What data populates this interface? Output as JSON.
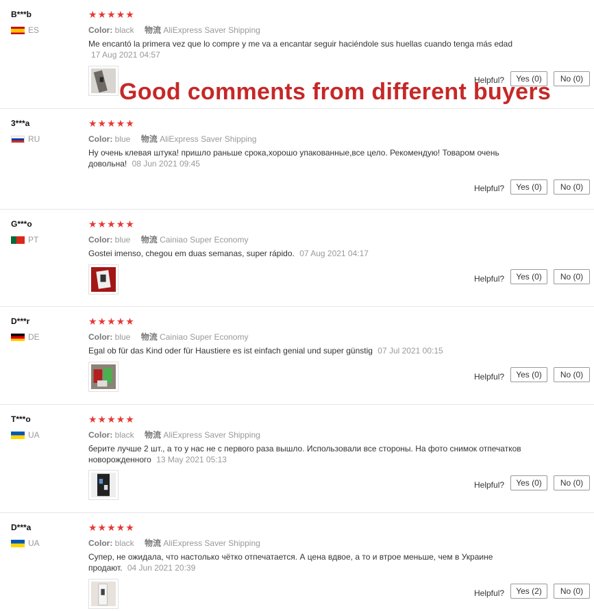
{
  "labels": {
    "color": "Color:",
    "logistics": "物流",
    "helpful": "Helpful?"
  },
  "overlay_text": "Good comments from different buyers",
  "reviews": [
    {
      "user": "B***b",
      "country": "ES",
      "stars": "★★★★★",
      "color": "black",
      "shipping": "AliExpress Saver Shipping",
      "comment": "Me encantó la primera vez que lo compre y me va a encantar seguir haciéndole sus huellas cuando tenga más edad",
      "date": "17 Aug 2021 04:57",
      "yes": "Yes (0)",
      "no": "No (0)"
    },
    {
      "user": "3***a",
      "country": "RU",
      "stars": "★★★★★",
      "color": "blue",
      "shipping": "AliExpress Saver Shipping",
      "comment": "Ну очень клевая штука! пришло раньше срока,хорошо упакованные,все цело. Рекомендую! Товаром очень довольна!",
      "date": "08 Jun 2021 09:45",
      "yes": "Yes (0)",
      "no": "No (0)"
    },
    {
      "user": "G***o",
      "country": "PT",
      "stars": "★★★★★",
      "color": "blue",
      "shipping": "Cainiao Super Economy",
      "comment": "Gostei imenso, chegou em duas semanas, super rápido.",
      "date": "07 Aug 2021 04:17",
      "yes": "Yes (0)",
      "no": "No (0)"
    },
    {
      "user": "D***r",
      "country": "DE",
      "stars": "★★★★★",
      "color": "blue",
      "shipping": "Cainiao Super Economy",
      "comment": "Egal ob für das Kind oder für Haustiere es ist einfach genial und super günstig",
      "date": "07 Jul 2021 00:15",
      "yes": "Yes (0)",
      "no": "No (0)"
    },
    {
      "user": "T***o",
      "country": "UA",
      "stars": "★★★★★",
      "color": "black",
      "shipping": "AliExpress Saver Shipping",
      "comment": "берите лучше 2 шт., а то у нас не с первого раза вышло. Использовали все стороны. На фото снимок отпечатков новорожденного",
      "date": "13 May 2021 05:13",
      "yes": "Yes (0)",
      "no": "No (0)"
    },
    {
      "user": "D***a",
      "country": "UA",
      "stars": "★★★★★",
      "color": "black",
      "shipping": "AliExpress Saver Shipping",
      "comment": "Супер, не ожидала, что настолько чётко отпечатается. А цена вдвое, а то и втрое меньше, чем в Украине продают.",
      "date": "04 Jun 2021 20:39",
      "yes": "Yes (2)",
      "no": "No (0)"
    }
  ]
}
